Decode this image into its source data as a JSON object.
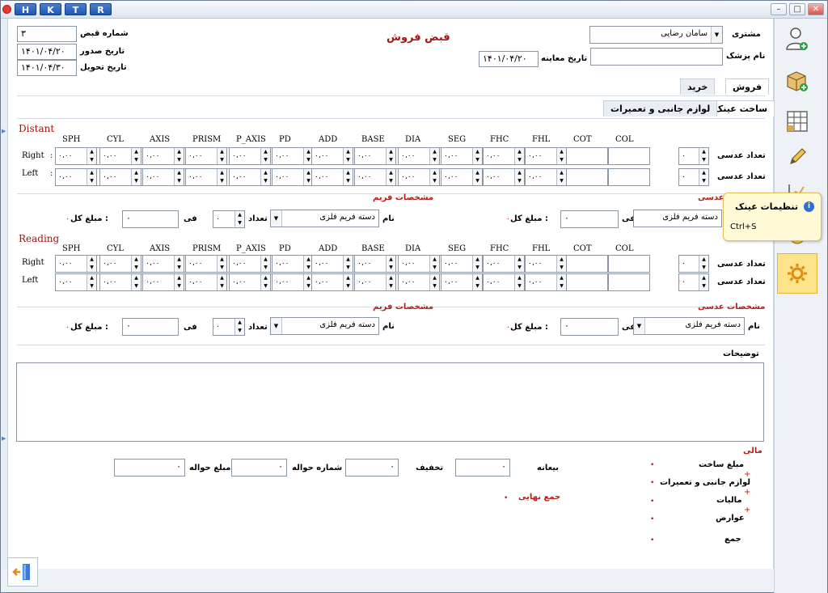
{
  "window": {
    "hk_buttons": [
      "H",
      "K",
      "T",
      "R"
    ],
    "min": "–",
    "max": "□",
    "close": "✕"
  },
  "header": {
    "title": "قبض فروش",
    "customer_label": "مشتری",
    "customer_value": "سامان رضایی",
    "doctor_label": "نام پزشک",
    "doctor_value": "",
    "exam_date_label": "تاریخ معاینه",
    "exam_date_value": "۱۴۰۱/۰۴/۲۰",
    "receipt_no_label": "شماره قبض",
    "receipt_no_value": "۳",
    "issue_date_label": "تاریخ صدور",
    "issue_date_value": "۱۴۰۱/۰۴/۲۰",
    "delivery_date_label": "تاریخ تحویل",
    "delivery_date_value": "۱۴۰۱/۰۴/۳۰"
  },
  "tabs": {
    "sale": "فروش",
    "purchase": "خرید",
    "sub_build": "ساخت عینک",
    "sub_accessories": "لوازم جانبی و تعمیرات"
  },
  "grid": {
    "columns": [
      "SPH",
      "CYL",
      "AXIS",
      "PRISM",
      "P_AXIS",
      "PD",
      "ADD",
      "BASE",
      "DIA",
      "SEG",
      "FHC",
      "FHL",
      "COT",
      "COL"
    ],
    "spin_value": "۰،۰۰",
    "right_label": "Right",
    "left_label": "Left",
    "colon": ":"
  },
  "distant": {
    "title": "Distant"
  },
  "reading": {
    "title": "Reading"
  },
  "lens": {
    "count_label": "تعداد عدسی",
    "count_value": "۰",
    "section_title": "مشخصات عدسی",
    "name_label": "نام",
    "name_value": "دسته فریم فلزی",
    "unit_label": "فی",
    "unit_value": "۰",
    "total_label": "مبلغ کل :",
    "total_value": "۰"
  },
  "frame": {
    "section_title": "مشخصات فریم",
    "name_label": "نام",
    "name_value": "دسته فریم فلزی",
    "count_label": "تعداد",
    "count_value": "۰",
    "unit_label": "فی",
    "unit_value": "۰",
    "total_label": "مبلغ کل :",
    "total_value": "۰"
  },
  "description_label": "توضیحات",
  "finance": {
    "title": "مالی",
    "build_amount": "مبلغ ساخت",
    "accessories": "لوازم جانبی و تعمیرات",
    "taxes": "مالیات",
    "duties": "عوارض",
    "sum": "جمع",
    "plus": "+",
    "dot": "•",
    "deposit_label": "بیعانه",
    "deposit_value": "۰",
    "discount_label": "تخفیف",
    "discount_value": "۰",
    "transfer_no_label": "شماره حواله",
    "transfer_no_value": "۰",
    "transfer_amount_label": "مبلغ حواله",
    "transfer_amount_value": "۰",
    "grand_total_label": "جمع نهایی",
    "grand_total_value": "•"
  },
  "tooltip": {
    "title": "تنظیمات عینک",
    "shortcut": "Ctrl+S",
    "info": "i"
  },
  "lens_title_cut": "عدسی",
  "colors": {
    "accent_red": "#b3201b",
    "hk_blue": "#1f56b0",
    "active_yellow": "#fde48a"
  }
}
